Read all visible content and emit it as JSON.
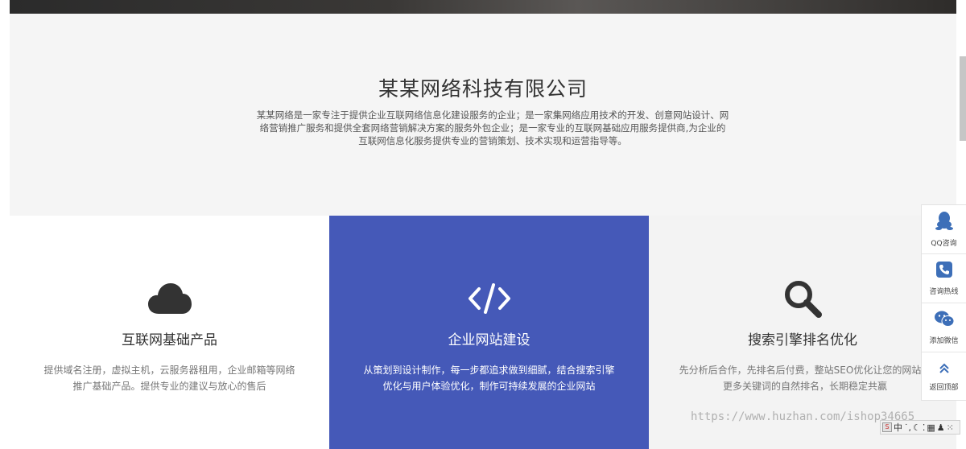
{
  "intro": {
    "title": "某某网络科技有限公司",
    "description": "某某网络是一家专注于提供企业互联网络信息化建设服务的企业；是一家集网络应用技术的开发、创意网站设计、网络营销推广服务和提供全套网络营销解决方案的服务外包企业；是一家专业的互联网基础应用服务提供商,为企业的互联网信息化服务提供专业的营销策划、技术实现和运营指导等。"
  },
  "cards": [
    {
      "icon": "cloud-icon",
      "title": "互联网基础产品",
      "text": "提供域名注册，虚拟主机，云服务器租用，企业邮箱等网络推广基础产品。提供专业的建议与放心的售后"
    },
    {
      "icon": "code-icon",
      "title": "企业网站建设",
      "text": "从策划到设计制作，每一步都追求做到细腻，结合搜索引擎优化与用户体验优化，制作可持续发展的企业网站"
    },
    {
      "icon": "search-icon",
      "title": "搜索引擎排名优化",
      "text": "先分析后合作，先排名后付费，整站SEO优化让您的网站有更多关键词的自然排名，长期稳定共赢"
    }
  ],
  "float_bar": {
    "items": [
      {
        "icon": "qq-icon",
        "label": "QQ咨询"
      },
      {
        "icon": "phone-icon",
        "label": "咨询热线"
      },
      {
        "icon": "wechat-icon",
        "label": "添加微信"
      },
      {
        "icon": "chevron-up-icon",
        "label": "返回顶部"
      }
    ]
  },
  "watermark": "https://www.huzhan.com/ishop34665",
  "ime": {
    "label": "中"
  },
  "colors": {
    "accent": "#4559b8",
    "icon_dark": "#333333",
    "float_icon": "#3d6fb8"
  }
}
